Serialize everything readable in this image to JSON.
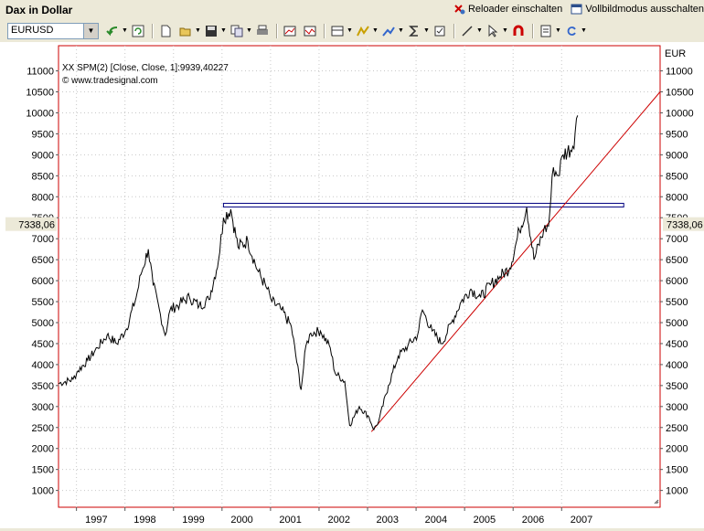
{
  "window": {
    "title": "Dax in Dollar",
    "reloader_label": "Reloader einschalten",
    "fullscreen_label": "Vollbildmodus ausschalten"
  },
  "toolbar": {
    "symbol_value": "EURUSD",
    "buttons": [
      "undo-arrow-icon",
      "refresh-icon",
      "new-doc-icon",
      "open-folder-icon",
      "save-disk-icon",
      "copy-icon",
      "print-icon",
      "chart-window-icon",
      "chart-export-icon",
      "layout-icon",
      "indicator-icon",
      "drawing-icon",
      "sigma-icon",
      "properties-icon",
      "line-tool-icon",
      "cursor-icon",
      "magnet-icon",
      "report-icon",
      "redo-icon"
    ]
  },
  "chart": {
    "legend_line": "XX SPM(2) [Close, Close, 1]:9939,40227",
    "copyright": "© www.tradesignal.com",
    "currency_label": "EUR",
    "current_value_label": "7338,06",
    "line_color": "#000000",
    "resistance_color": "#000080",
    "trend_color": "#cc0000",
    "frame_color": "#cc0000"
  },
  "chart_data": {
    "type": "line",
    "x_tick_labels": [
      "1997",
      "1998",
      "1999",
      "2000",
      "2001",
      "2002",
      "2003",
      "2004",
      "2005",
      "2006",
      "2007"
    ],
    "y_ticks": [
      1000,
      1500,
      2000,
      2500,
      3000,
      3500,
      4000,
      4500,
      5000,
      5500,
      6000,
      6500,
      7000,
      7500,
      8000,
      8500,
      9000,
      9500,
      10000,
      10500,
      11000
    ],
    "ylim": [
      600,
      11600
    ],
    "xlim": [
      1996.6,
      2009.0
    ],
    "series": [
      {
        "x": [
          1996.6,
          1996.9,
          1997.0,
          1997.2,
          1997.4,
          1997.6,
          1997.8,
          1998.0,
          1998.2,
          1998.3,
          1998.45,
          1998.55,
          1998.7,
          1998.8,
          1998.9,
          1999.1,
          1999.3,
          1999.5,
          1999.7,
          1999.9,
          2000.0,
          2000.15,
          2000.3,
          2000.5,
          2000.7,
          2000.9,
          2001.0,
          2001.2,
          2001.4,
          2001.6,
          2001.7,
          2001.8,
          2002.0,
          2002.2,
          2002.3,
          2002.5,
          2002.6,
          2002.8,
          2003.0,
          2003.1,
          2003.2,
          2003.4,
          2003.6,
          2003.8,
          2004.0,
          2004.1,
          2004.3,
          2004.5,
          2004.7,
          2004.9,
          2005.1,
          2005.3,
          2005.5,
          2005.7,
          2005.9,
          2006.1,
          2006.25,
          2006.4,
          2006.6,
          2006.7,
          2006.8,
          2006.9,
          2007.0,
          2007.2,
          2007.3
        ],
        "y": [
          3550,
          3650,
          3850,
          4100,
          4400,
          4700,
          4500,
          4850,
          5600,
          6150,
          6750,
          5900,
          5200,
          4700,
          5300,
          5450,
          5600,
          5400,
          5550,
          6500,
          7500,
          7700,
          6800,
          6950,
          6250,
          5800,
          5500,
          5300,
          4900,
          3400,
          4450,
          4750,
          4800,
          4400,
          3800,
          3600,
          2550,
          3000,
          2750,
          2450,
          2650,
          3500,
          4200,
          4450,
          4700,
          5300,
          4800,
          4500,
          5000,
          5500,
          5800,
          5600,
          5900,
          6100,
          6300,
          7200,
          7750,
          6500,
          7200,
          7300,
          8700,
          8500,
          9000,
          9200,
          9939
        ]
      }
    ],
    "resistance_level": 7800,
    "trendline": [
      [
        2003.05,
        2400
      ],
      [
        2009.0,
        10500
      ]
    ]
  }
}
